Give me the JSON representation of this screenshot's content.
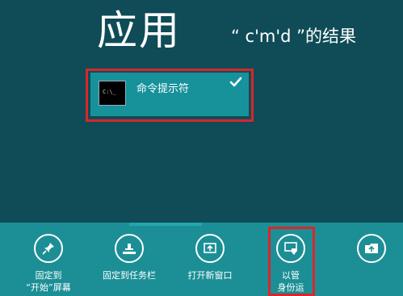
{
  "header": {
    "title": "应用",
    "subtitle": "“ c'm'd ”的结果"
  },
  "results": [
    {
      "label": "命令提示符",
      "icon": "command-prompt-icon",
      "prompt_text": "C:\\_",
      "selected": true
    }
  ],
  "app_bar": {
    "commands": [
      {
        "label_line1": "固定到",
        "label_line2": "“开始”屏幕",
        "icon": "pin-icon"
      },
      {
        "label_line1": "固定到任务栏",
        "label_line2": "",
        "icon": "pin-taskbar-icon"
      },
      {
        "label_line1": "打开新窗口",
        "label_line2": "",
        "icon": "new-window-icon"
      },
      {
        "label_line1": "以管",
        "label_line2": "身份运",
        "icon": "run-as-admin-shield-icon"
      },
      {
        "label_line1": "",
        "label_line2": "",
        "icon": "open-file-location-icon"
      }
    ]
  },
  "colors": {
    "background": "#0f4c57",
    "tile": "#17929a",
    "app_bar": "#1c8f96",
    "highlight_frame": "#d9262a"
  }
}
